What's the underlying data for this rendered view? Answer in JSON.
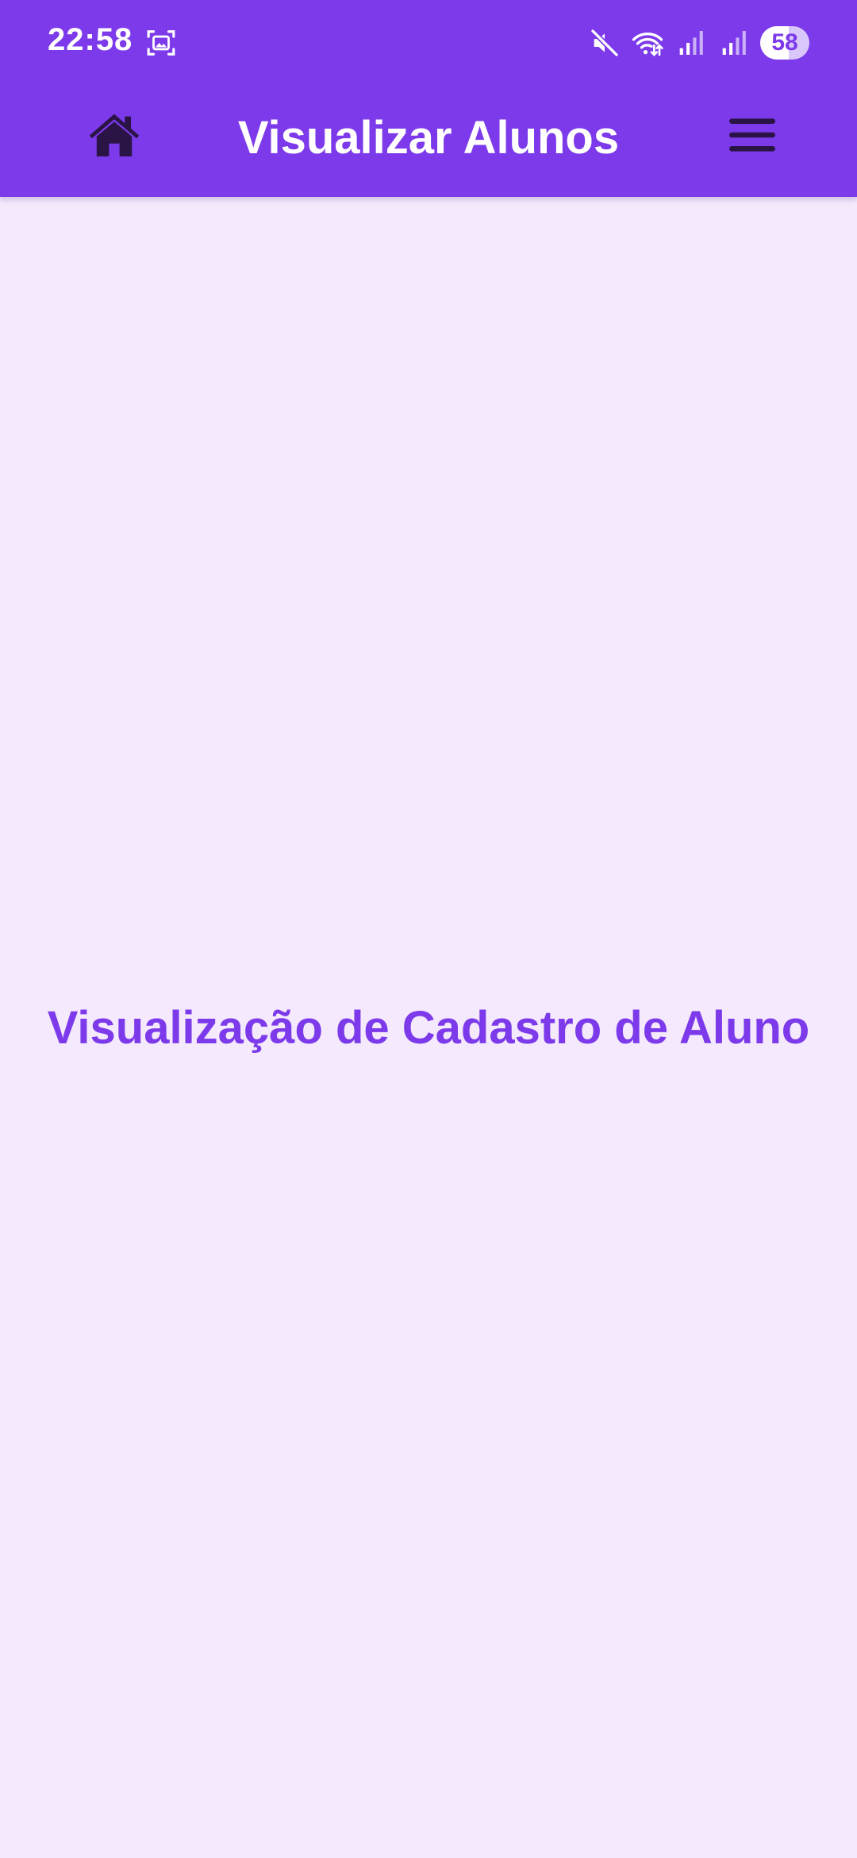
{
  "status_bar": {
    "time": "22:58",
    "battery_level": "58",
    "icons": [
      "screenshot-icon",
      "mute-icon",
      "wifi-icon",
      "signal-icon",
      "signal-icon",
      "battery-icon"
    ]
  },
  "app_bar": {
    "title": "Visualizar Alunos",
    "left_icon": "home-icon",
    "right_icon": "menu-icon"
  },
  "main": {
    "heading": "Visualização de Cadastro de Aluno"
  },
  "colors": {
    "primary": "#7C3AEA",
    "background": "#F4E9FD",
    "icon_dark": "#2A1446",
    "on_primary": "#FFFFFF"
  }
}
